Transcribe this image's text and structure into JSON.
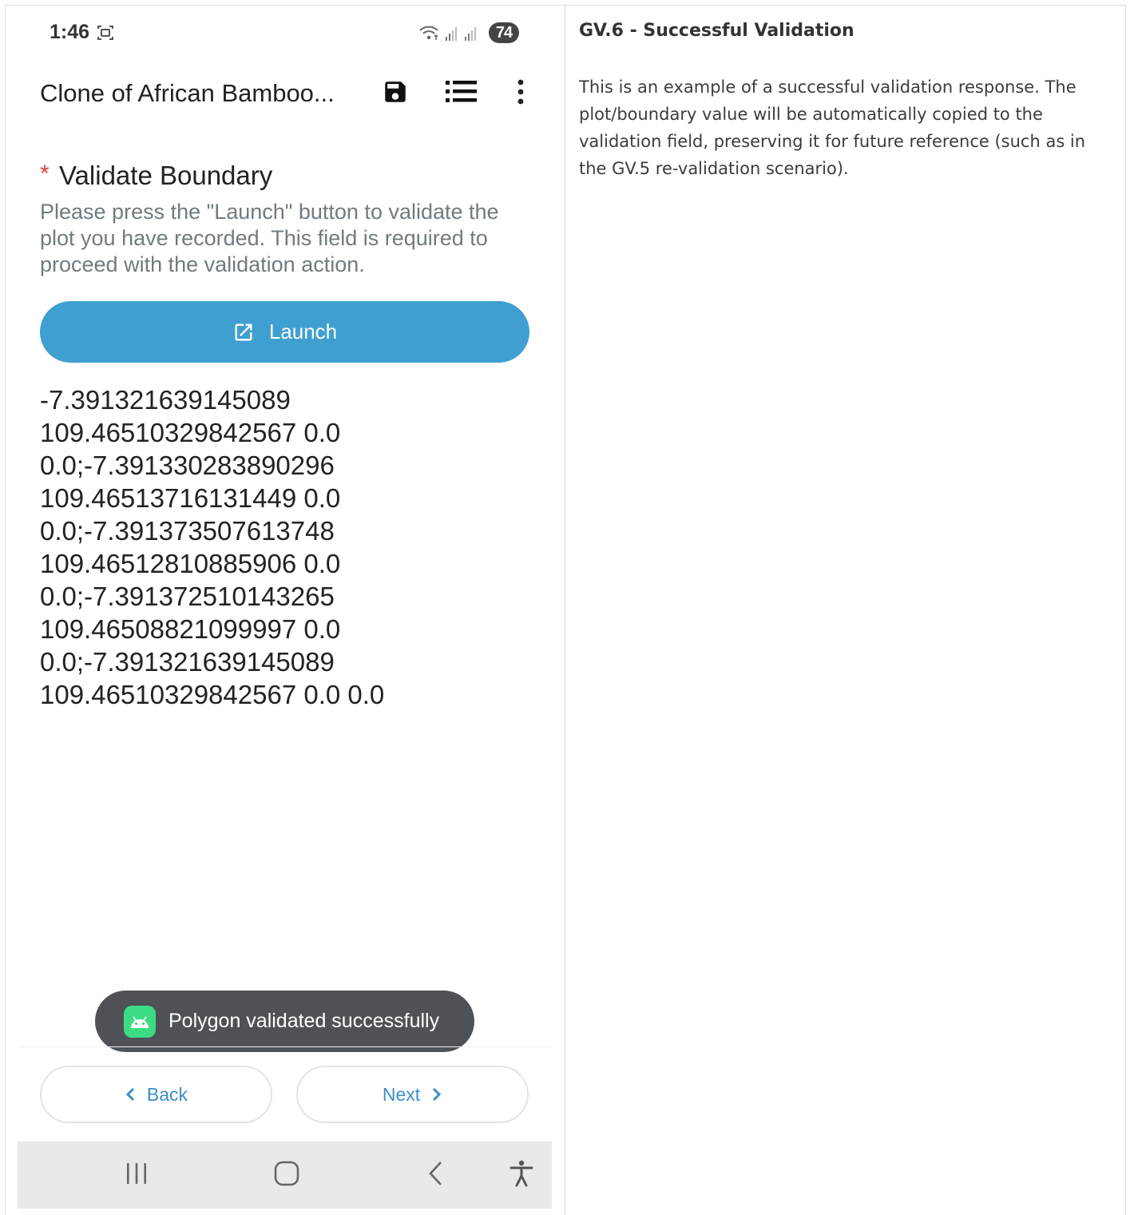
{
  "status_bar": {
    "time": "1:46",
    "battery": "74"
  },
  "toolbar": {
    "title": "Clone of African Bamboo..."
  },
  "field": {
    "required_mark": "*",
    "label": "Validate Boundary",
    "hint": "Please press the \"Launch\" button to validate the plot you have recorded. This field is required to proceed with the validation action.",
    "launch_label": "Launch",
    "value": "-7.391321639145089 109.46510329842567 0.0 0.0;-7.391330283890296 109.46513716131449 0.0 0.0;-7.391373507613748 109.46512810885906 0.0 0.0;-7.391372510143265 109.46508821099997 0.0 0.0;-7.391321639145089 109.46510329842567 0.0 0.0"
  },
  "toast": {
    "message": "Polygon validated successfully"
  },
  "navigation": {
    "back_label": "Back",
    "next_label": "Next"
  },
  "description": {
    "title": "GV.6 - Successful Validation",
    "body": "This is an example of a successful validation response. The plot/boundary value will be automatically copied to the validation field, preserving it for future reference (such as in the GV.5 re-validation scenario)."
  },
  "colors": {
    "accent": "#3f9fd0",
    "required": "#e53935",
    "toast_bg": "#4e5256",
    "android_green": "#3ddc84"
  }
}
